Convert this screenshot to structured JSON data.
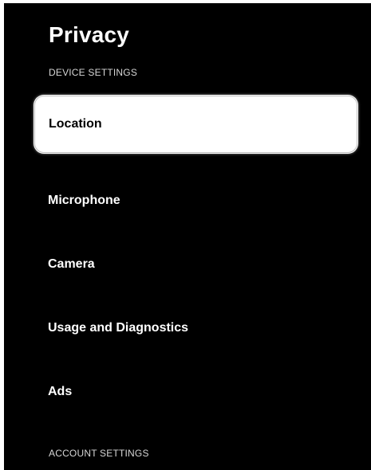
{
  "header": {
    "title": "Privacy"
  },
  "sections": {
    "device_settings": "DEVICE SETTINGS",
    "account_settings": "ACCOUNT SETTINGS"
  },
  "device_items": [
    {
      "label": "Location",
      "focused": true
    },
    {
      "label": "Microphone",
      "focused": false
    },
    {
      "label": "Camera",
      "focused": false
    },
    {
      "label": "Usage and Diagnostics",
      "focused": false
    },
    {
      "label": "Ads",
      "focused": false
    }
  ],
  "colors": {
    "background": "#000000",
    "text": "#ffffff",
    "focus_background": "#ffffff",
    "focus_text": "#000000"
  }
}
